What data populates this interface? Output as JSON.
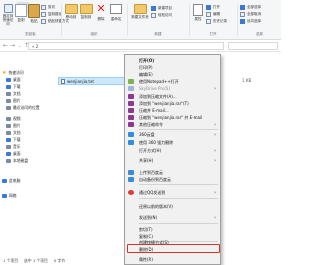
{
  "ribbon": {
    "clipboard": {
      "pin_label": "固定到快速访问",
      "copy_label": "复制",
      "paste_label": "粘贴",
      "cut_label": "剪切",
      "copy_path_label": "复制路径",
      "paste_shortcut_label": "粘贴快捷方式",
      "group_title": "剪贴板"
    },
    "organize": {
      "move_to_label": "移动到",
      "copy_to_label": "复制到",
      "delete_label": "删除",
      "rename_label": "重命名",
      "group_title": "组织"
    },
    "new": {
      "new_folder_label": "新建文件夹",
      "new_item_label": "新建项目",
      "easy_access_label": "轻松访问",
      "group_title": "新建"
    },
    "open": {
      "properties_label": "属性",
      "open_label": "打开",
      "edit_label": "编辑",
      "history_label": "历史记录",
      "group_title": "打开"
    },
    "select": {
      "select_all_label": "全部选择",
      "select_none_label": "全部取消",
      "invert_label": "反向选择",
      "group_title": "选择"
    }
  },
  "address_bar": {
    "path": "« 2"
  },
  "nav_pane": {
    "items": [
      {
        "label": "快速访问",
        "color": "#3b78d8"
      },
      {
        "label": "桌面",
        "color": "#3b78d8"
      },
      {
        "label": "下载",
        "color": "#3b78d8"
      },
      {
        "label": "文档",
        "color": "#7a8aa0"
      },
      {
        "label": "图片",
        "color": "#7a8aa0"
      },
      {
        "label": "最近访问的位置",
        "color": "#7a8aa0"
      },
      {
        "label": "视频",
        "color": "#7a8aa0"
      },
      {
        "label": "图片",
        "color": "#7a8aa0"
      },
      {
        "label": "文档",
        "color": "#7a8aa0"
      },
      {
        "label": "下载",
        "color": "#3b78d8"
      },
      {
        "label": "音乐",
        "color": "#7a8aa0"
      },
      {
        "label": "桌面",
        "color": "#3b78d8"
      },
      {
        "label": "本地磁盘",
        "color": "#7a8aa0"
      },
      {
        "label": "此电脑",
        "color": "#3b78d8"
      },
      {
        "label": "网络",
        "color": "#3b78d8"
      }
    ]
  },
  "file_list": {
    "file_name": "wenjianjia.txt",
    "file_size": "1 KB"
  },
  "status_bar": {
    "item_count": "1 个项目",
    "selected": "选中 1 个项目",
    "size": "0 字节"
  },
  "context_menu": {
    "items": [
      {
        "label": "打开(O)",
        "type": "item"
      },
      {
        "label": "打印(P)",
        "type": "item"
      },
      {
        "label": "编辑(E)",
        "type": "item"
      },
      {
        "label": "使用Notepad++打开",
        "type": "item"
      },
      {
        "label": "SkyDrive Pro(S)",
        "type": "submenu-disabled"
      },
      {
        "label": "添加到压缩文件(A)...",
        "type": "rar"
      },
      {
        "label": "添加到 \"wenjianjia.rar\"(T)",
        "type": "rar"
      },
      {
        "label": "压缩并 E-mail...",
        "type": "rar"
      },
      {
        "label": "压缩到 \"wenjianjia.rar\" 并 E-mail",
        "type": "rar"
      },
      {
        "label": "其他压缩命令",
        "type": "rar-submenu"
      },
      {
        "label": "360云盘",
        "type": "cloud-submenu"
      },
      {
        "label": "使用 360 强力删除",
        "type": "shield"
      },
      {
        "label": "打开方式(H)",
        "type": "submenu"
      },
      {
        "label": "共享(H)",
        "type": "submenu"
      },
      {
        "label": "上传到百度云",
        "type": "cloud"
      },
      {
        "label": "自动备份到百度云",
        "type": "cloud"
      },
      {
        "label": "通过QQ发送到",
        "type": "qq-submenu"
      },
      {
        "label": "还原以前的版本(V)",
        "type": "item"
      },
      {
        "label": "发送到(N)",
        "type": "submenu"
      },
      {
        "label": "剪切(T)",
        "type": "item"
      },
      {
        "label": "复制(C)",
        "type": "item"
      },
      {
        "label": "创建快捷方式(S)",
        "type": "item"
      },
      {
        "label": "删除(D)",
        "type": "item"
      },
      {
        "label": "重命名(M)",
        "type": "item-highlighted"
      },
      {
        "label": "属性(R)",
        "type": "item"
      }
    ]
  },
  "colors": {
    "highlight_border": "#d9342b",
    "selection_fill": "#cce8ff",
    "accent": "#3b78d8"
  }
}
